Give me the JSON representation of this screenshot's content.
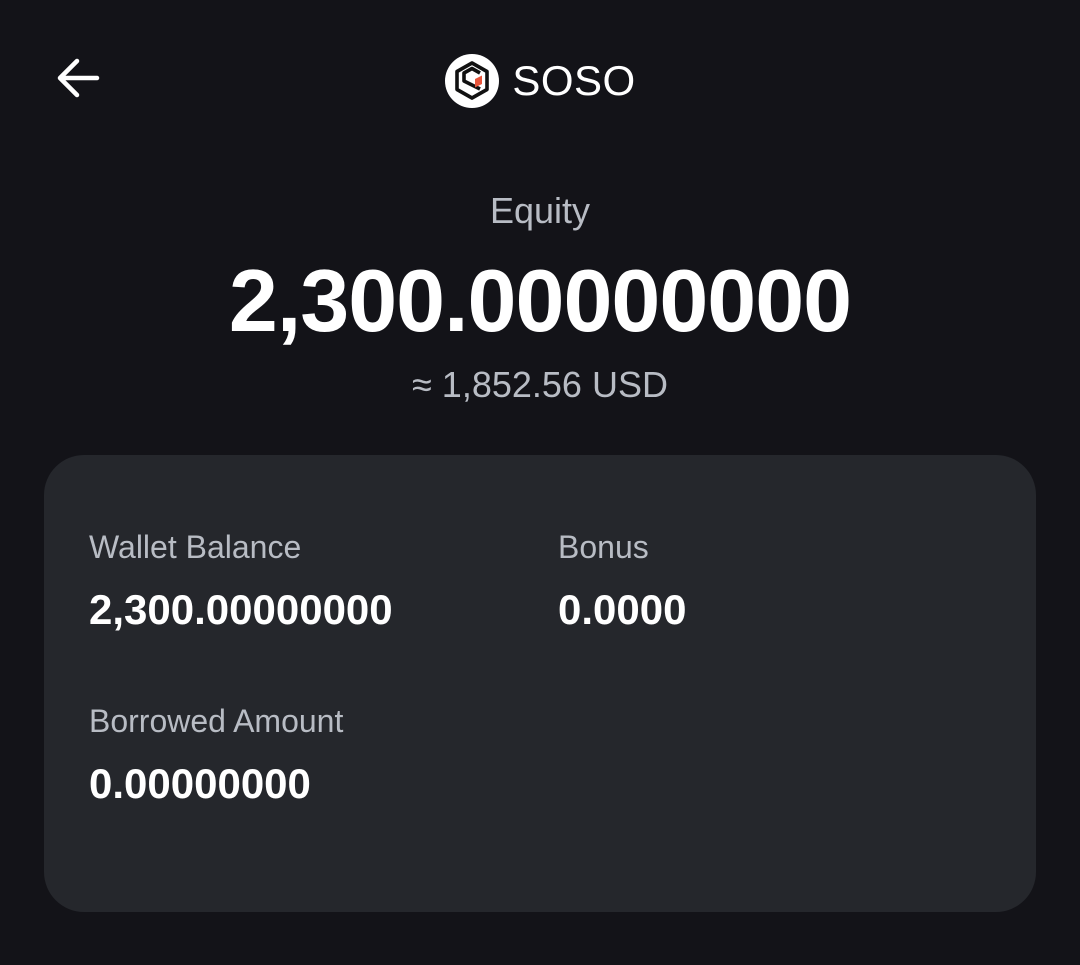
{
  "header": {
    "back_icon": "arrow-left-icon",
    "coin_icon": "soso-logo-icon",
    "coin_name": "SOSO"
  },
  "equity": {
    "label": "Equity",
    "value": "2,300.00000000",
    "usd_equivalent": "≈ 1,852.56 USD"
  },
  "details": {
    "wallet_balance": {
      "label": "Wallet Balance",
      "value": "2,300.00000000"
    },
    "bonus": {
      "label": "Bonus",
      "value": "0.0000"
    },
    "borrowed_amount": {
      "label": "Borrowed Amount",
      "value": "0.00000000"
    }
  },
  "colors": {
    "background": "#131318",
    "card": "#25272c",
    "muted_text": "#b8bcc4",
    "primary_text": "#ffffff",
    "logo_accent": "#e8553b"
  }
}
